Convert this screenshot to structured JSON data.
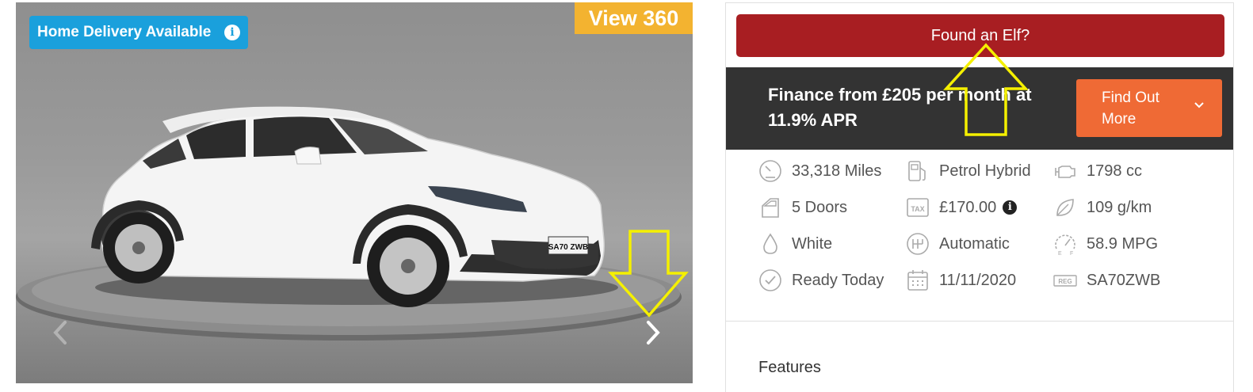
{
  "gallery": {
    "badge_delivery": "Home Delivery Available",
    "badge_360": "View 360",
    "plate": "SA70 ZWB",
    "icons": {
      "info": "info-icon",
      "prev": "chevron-left-icon",
      "next": "chevron-right-icon"
    }
  },
  "panel": {
    "elf_button": "Found an Elf?",
    "finance": {
      "text": "Finance from £205 per month at 11.9% APR",
      "button": "Find Out More"
    },
    "specs": [
      {
        "icon": "odometer-icon",
        "value": "33,318 Miles"
      },
      {
        "icon": "fuel-pump-icon",
        "value": "Petrol Hybrid"
      },
      {
        "icon": "engine-icon",
        "value": "1798 cc"
      },
      {
        "icon": "car-door-icon",
        "value": "5 Doors"
      },
      {
        "icon": "tax-icon",
        "value": "£170.00"
      },
      {
        "icon": "leaf-icon",
        "value": "109 g/km"
      },
      {
        "icon": "paint-drop-icon",
        "value": "White"
      },
      {
        "icon": "gearbox-icon",
        "value": "Automatic"
      },
      {
        "icon": "fuel-gauge-icon",
        "value": "58.9 MPG"
      },
      {
        "icon": "check-circle-icon",
        "value": "Ready Today"
      },
      {
        "icon": "calendar-icon",
        "value": "11/11/2020"
      },
      {
        "icon": "reg-plate-icon",
        "value": "SA70ZWB"
      }
    ],
    "features_title": "Features"
  },
  "colors": {
    "delivery_badge": "#1aa0dc",
    "view360_badge": "#f3b330",
    "elf_button": "#a81e22",
    "finance_bar": "#333333",
    "find_out_button": "#ef6a35",
    "annotation_arrows": "#f5f000"
  }
}
